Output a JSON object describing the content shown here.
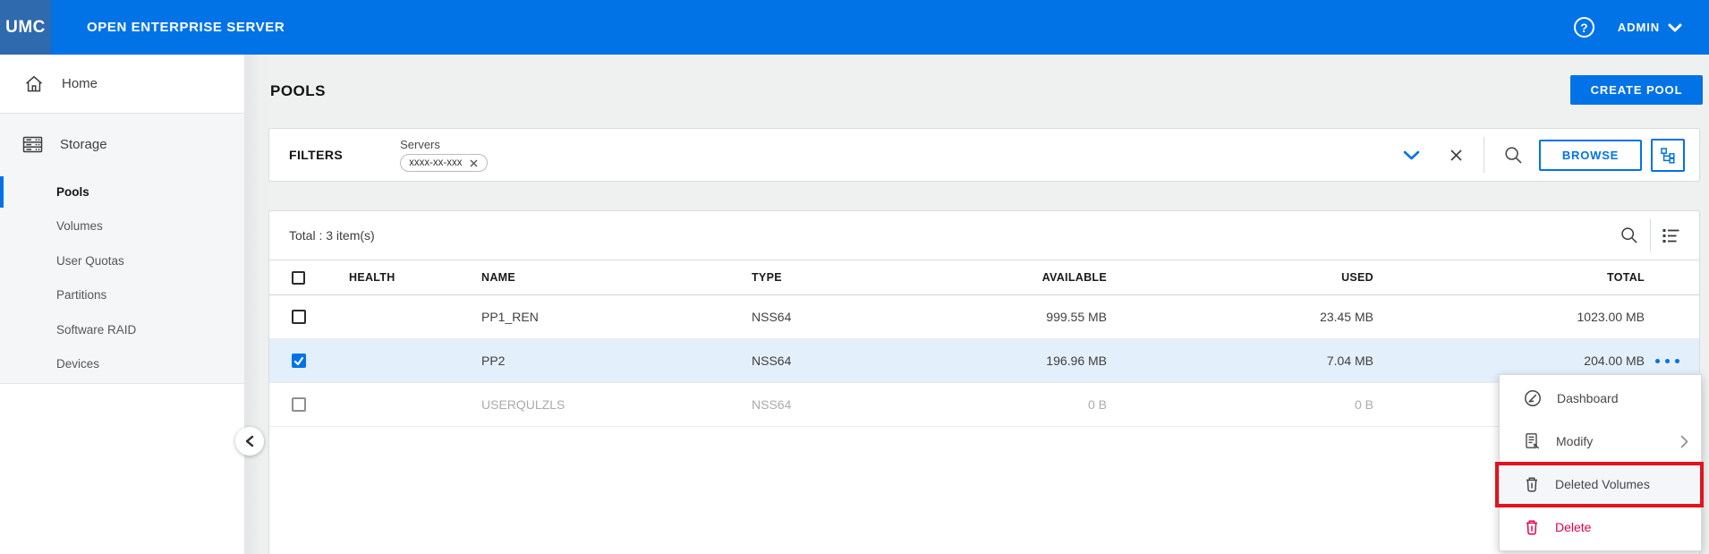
{
  "topbar": {
    "logo": "UMC",
    "product": "OPEN ENTERPRISE SERVER",
    "user_menu": "ADMIN"
  },
  "sidebar": {
    "home": "Home",
    "storage": "Storage",
    "items": [
      {
        "label": "Pools",
        "active": true
      },
      {
        "label": "Volumes",
        "active": false
      },
      {
        "label": "User Quotas",
        "active": false
      },
      {
        "label": "Partitions",
        "active": false
      },
      {
        "label": "Software RAID",
        "active": false
      },
      {
        "label": "Devices",
        "active": false
      }
    ]
  },
  "page": {
    "title": "POOLS",
    "create_button": "CREATE POOL"
  },
  "filters": {
    "label": "FILTERS",
    "group_label": "Servers",
    "chip": "xxxx-xx-xxx",
    "browse_button": "BROWSE"
  },
  "table": {
    "summary": "Total : 3 item(s)",
    "columns": {
      "health": "HEALTH",
      "name": "NAME",
      "type": "TYPE",
      "available": "AVAILABLE",
      "used": "USED",
      "total": "TOTAL"
    },
    "rows": [
      {
        "name": "PP1_REN",
        "type": "NSS64",
        "available": "999.55 MB",
        "used": "23.45 MB",
        "total": "1023.00 MB",
        "health": "ok",
        "checked": false,
        "selected": false,
        "disabled": false,
        "has_actions": false
      },
      {
        "name": "PP2",
        "type": "NSS64",
        "available": "196.96 MB",
        "used": "7.04 MB",
        "total": "204.00 MB",
        "health": "ok",
        "checked": true,
        "selected": true,
        "disabled": false,
        "has_actions": true
      },
      {
        "name": "USERQULZLS",
        "type": "NSS64",
        "available": "0 B",
        "used": "0 B",
        "total": "",
        "health": "off",
        "checked": false,
        "selected": false,
        "disabled": true,
        "has_actions": false
      }
    ]
  },
  "context_menu": {
    "items": [
      {
        "label": "Dashboard",
        "icon": "dashboard-icon",
        "has_submenu": false,
        "highlighted": false,
        "danger": false
      },
      {
        "label": "Modify",
        "icon": "modify-icon",
        "has_submenu": true,
        "highlighted": false,
        "danger": false
      },
      {
        "label": "Deleted Volumes",
        "icon": "trash-icon",
        "has_submenu": false,
        "highlighted": true,
        "danger": false
      },
      {
        "label": "Delete",
        "icon": "trash-icon",
        "has_submenu": false,
        "highlighted": false,
        "danger": true
      }
    ]
  },
  "colors": {
    "accent": "#0173E7",
    "topbar": "#0173E7",
    "logo_box": "#2F69AE",
    "health_ok": "#21A346",
    "health_off": "#DBDBDB",
    "selected_row": "#E3EFFB",
    "danger": "#E5004C",
    "annotation": "#E2131D"
  }
}
